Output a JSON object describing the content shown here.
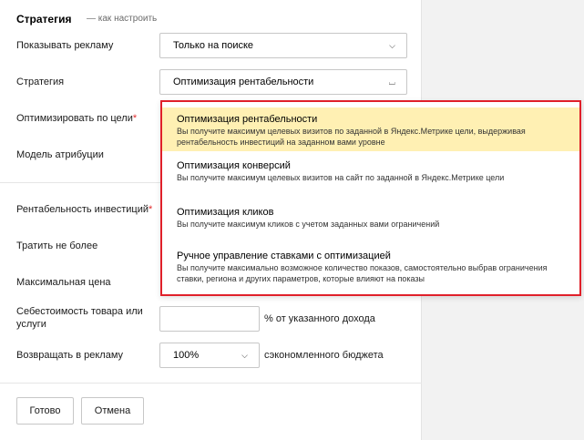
{
  "header": {
    "title": "Стратегия",
    "link": "— как настроить"
  },
  "form": {
    "show_ads": {
      "label": "Показывать рекламу",
      "value": "Только на поиске"
    },
    "strategy": {
      "label": "Стратегия",
      "value": "Оптимизация рентабельности"
    },
    "optimize_goal": {
      "label": "Оптимизировать по цели",
      "required": "*"
    },
    "attribution": {
      "label": "Модель атрибуции"
    },
    "roi": {
      "label": "Рентабельность инвестиций",
      "required": "*"
    },
    "spend_limit": {
      "label": "Тратить не более"
    },
    "max_price": {
      "label": "Максимальная цена"
    },
    "cost": {
      "label": "Себестоимость товара или услуги",
      "value": "",
      "suffix": "% от указанного дохода"
    },
    "return": {
      "label": "Возвращать в рекламу",
      "value": "100%",
      "suffix": "сэкономленного бюджета"
    }
  },
  "buttons": {
    "done": "Готово",
    "cancel": "Отмена"
  },
  "dropdown": {
    "selected_index": 0,
    "options": [
      {
        "title": "Оптимизация рентабельности",
        "desc_line1": "Вы получите максимум целевых визитов по заданной в Яндекс.Метрике цели, выдерживая",
        "desc_line2": "рентабельность инвестиций на заданном вами уровне"
      },
      {
        "title": "Оптимизация конверсий",
        "desc_line1": "Вы получите максимум целевых визитов на сайт по заданной в Яндекс.Метрике цели",
        "desc_line2": ""
      },
      {
        "title": "Оптимизация кликов",
        "desc_line1": "Вы получите максимум кликов с учетом заданных вами ограничений",
        "desc_line2": ""
      },
      {
        "title": "Ручное управление ставками с оптимизацией",
        "desc_line1": "Вы получите максимально возможное количество показов, самостоятельно выбрав ограничения",
        "desc_line2": "ставки, региона и других параметров, которые влияют на показы"
      }
    ]
  },
  "colors": {
    "highlight": "#fff0b3",
    "annotation_border": "#e0202a",
    "required": "#e02c2c"
  },
  "icons": {
    "select_closed": "chevron-down-icon",
    "select_open": "chevron-up-icon"
  }
}
